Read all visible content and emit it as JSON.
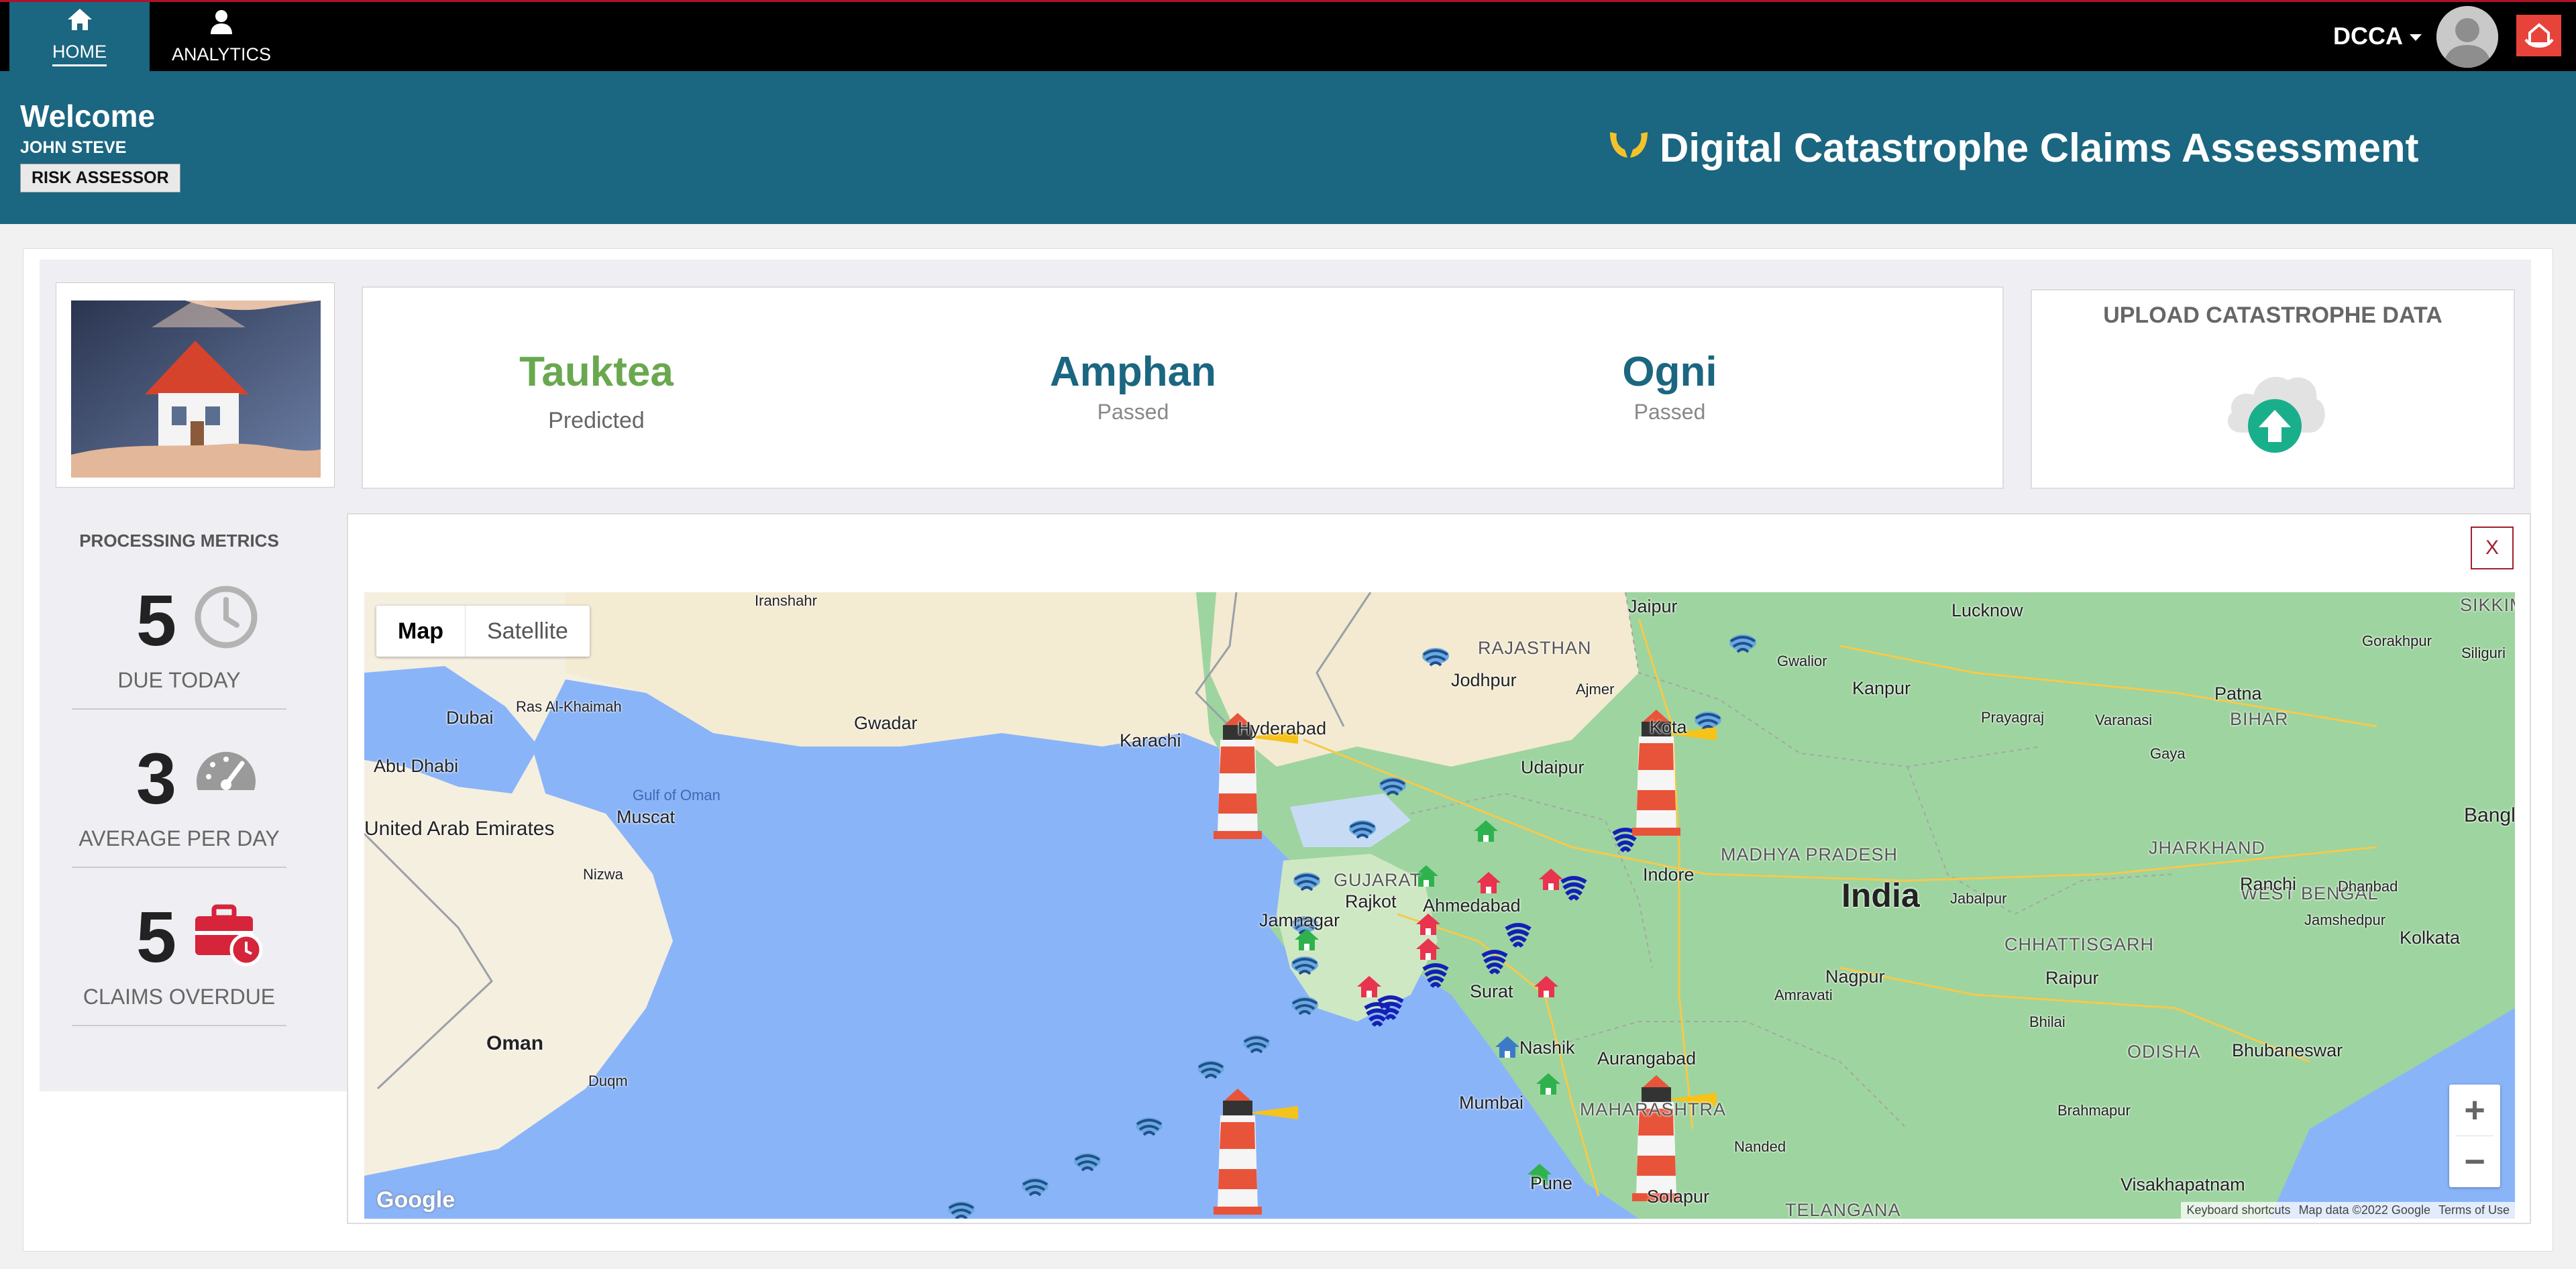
{
  "nav": {
    "tabs": [
      {
        "label": "HOME",
        "icon": "home-icon"
      },
      {
        "label": "ANALYTICS",
        "icon": "user-icon"
      }
    ],
    "user_menu": "DCCA"
  },
  "banner": {
    "welcome": "Welcome",
    "user_name": "JOHN STEVE",
    "role": "RISK ASSESSOR",
    "app_title": "Digital Catastrophe Claims Assessment"
  },
  "storms": [
    {
      "name": "Tauktea",
      "status": "Predicted",
      "color": "#6aa84f"
    },
    {
      "name": "Amphan",
      "status": "Passed",
      "color": "#1b6680"
    },
    {
      "name": "Ogni",
      "status": "Passed",
      "color": "#1b6680"
    }
  ],
  "upload": {
    "title": "UPLOAD CATASTROPHE DATA"
  },
  "metrics": {
    "title": "PROCESSING METRICS",
    "items": [
      {
        "value": "5",
        "label": "DUE TODAY",
        "icon": "clock-icon"
      },
      {
        "value": "3",
        "label": "AVERAGE PER DAY",
        "icon": "gauge-icon"
      },
      {
        "value": "5",
        "label": "CLAIMS OVERDUE",
        "icon": "briefcase-clock-icon"
      }
    ]
  },
  "map": {
    "close_label": "X",
    "type_map": "Map",
    "type_satellite": "Satellite",
    "zoom_in": "+",
    "zoom_out": "−",
    "google": "Google",
    "attribution": [
      "Keyboard shortcuts",
      "Map data ©2022 Google",
      "Terms of Use"
    ],
    "country_label": "India",
    "region_labels": [
      "RAJASTHAN",
      "GUJARAT",
      "MADHYA PRADESH",
      "MAHARASHTRA",
      "JHARKHAND",
      "WEST BENGAL",
      "CHHATTISGARH",
      "ODISHA",
      "BIHAR",
      "SIKKIM",
      "TELANGANA"
    ],
    "city_labels": [
      "Jaipur",
      "Lucknow",
      "Kanpur",
      "Patna",
      "Karachi",
      "Hyderabad",
      "Jodhpur",
      "Udaipur",
      "Kota",
      "Indore",
      "Ahmedabad",
      "Rajkot",
      "Jamnagar",
      "Surat",
      "Nashik",
      "Mumbai",
      "Pune",
      "Aurangabad",
      "Nagpur",
      "Ranchi",
      "Kolkata",
      "Raipur",
      "Bhubaneswar",
      "Visakhapatnam",
      "Solapur",
      "Dubai",
      "Abu Dhabi",
      "Muscat",
      "Oman",
      "Gwadar",
      "Nizwa",
      "Ras Al-Khaimah",
      "United Arab Emirates",
      "Gwalior",
      "Varanasi",
      "Prayagraj",
      "Gaya",
      "Ajmer",
      "Amravati",
      "Jabalpur",
      "Bhilai",
      "Brahmapur",
      "Nanded",
      "Iranshahr",
      "Duqm",
      "Siliguri",
      "Gorakhpur",
      "Dhanbad",
      "Jamshedpur",
      "Bangladesh"
    ],
    "sea_label": "Gulf of Oman"
  }
}
